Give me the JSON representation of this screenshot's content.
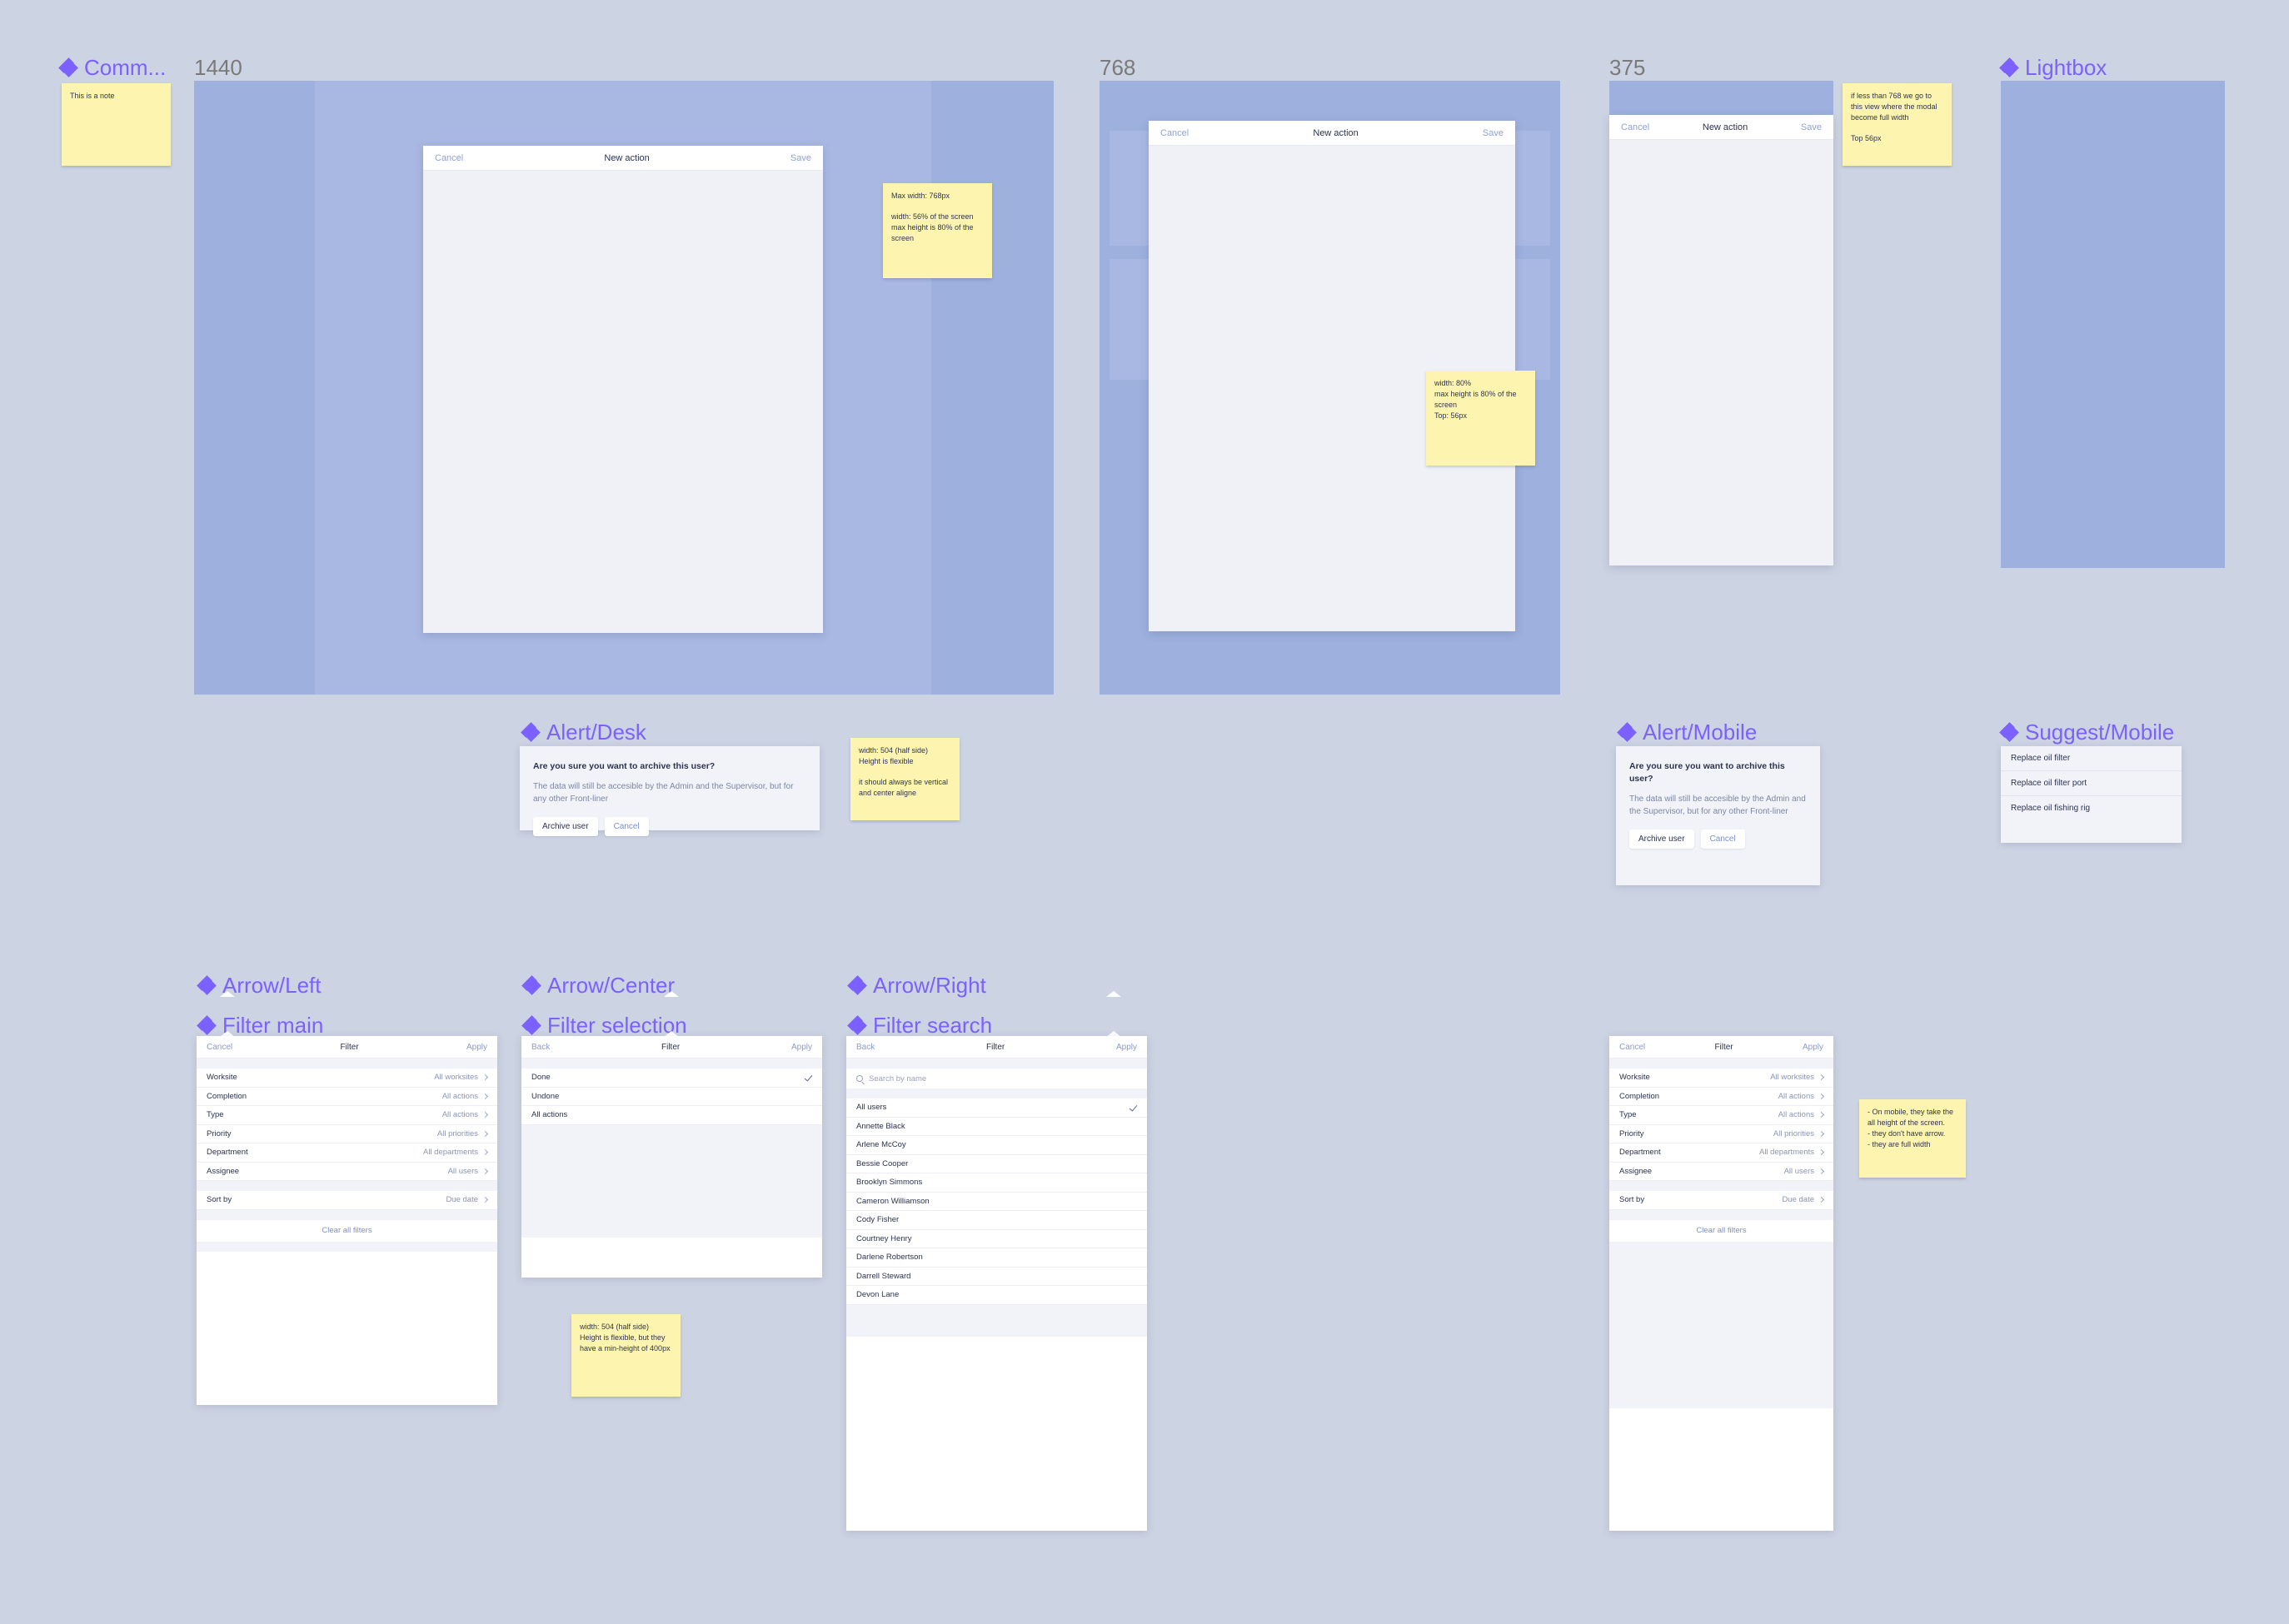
{
  "canvas": {
    "background": "#ccd3e3",
    "component_color": "#7b61ff",
    "frame_fill": "#9db0de"
  },
  "component_labels": {
    "comment": "Comm...",
    "lightbox": "Lightbox",
    "alert_desk": "Alert/Desk",
    "alert_mobile": "Alert/Mobile",
    "suggest_mobile": "Suggest/Mobile",
    "arrow_left": "Arrow/Left",
    "arrow_center": "Arrow/Center",
    "arrow_right": "Arrow/Right",
    "filter_main": "Filter main",
    "filter_selection": "Filter selection",
    "filter_search": "Filter search"
  },
  "frames": {
    "desktop_1440": "1440",
    "tablet_768": "768",
    "mobile_375": "375"
  },
  "notes": {
    "comment_note": [
      "This is a note"
    ],
    "desktop_modal": [
      "Max width: 768px",
      "width: 56% of the screen",
      "max height is 80% of the screen"
    ],
    "tablet_modal": [
      "width: 80%",
      "max height is 80% of the screen",
      "Top: 56px"
    ],
    "mobile_modal": [
      "if less than 768 we go to this view where the modal become full width",
      "Top 56px"
    ],
    "alert_note": [
      "width: 504 (half side)",
      "Height is flexible",
      "it should always be vertical and center aligne"
    ],
    "filter_note": [
      "width: 504 (half side)",
      "Height is flexible, but they have a min-height of 400px"
    ],
    "mobile_filter_note": [
      "- On mobile, they take the all height of the screen.",
      "- they don't have arrow.",
      "- they are full width"
    ]
  },
  "modal": {
    "cancel": "Cancel",
    "title": "New action",
    "save": "Save"
  },
  "alert": {
    "heading": "Are you sure you want to archive this user?",
    "body": "The data will still be accesible by the Admin and the Supervisor, but for any other Front-liner",
    "confirm": "Archive user",
    "cancel": "Cancel"
  },
  "suggest": {
    "items": [
      "Replace oil filter",
      "Replace oil filter port",
      "Replace oil fishing rig"
    ]
  },
  "filter_main": {
    "cancel": "Cancel",
    "title": "Filter",
    "apply": "Apply",
    "rows": [
      {
        "label": "Worksite",
        "value": "All worksites"
      },
      {
        "label": "Completion",
        "value": "All actions"
      },
      {
        "label": "Type",
        "value": "All actions"
      },
      {
        "label": "Priority",
        "value": "All priorities"
      },
      {
        "label": "Department",
        "value": "All departments"
      },
      {
        "label": "Assignee",
        "value": "All users"
      }
    ],
    "sort": {
      "label": "Sort by",
      "value": "Due date"
    },
    "clear": "Clear all filters"
  },
  "filter_selection": {
    "back": "Back",
    "title": "Filter",
    "apply": "Apply",
    "options": [
      {
        "label": "Done",
        "selected": true
      },
      {
        "label": "Undone",
        "selected": false
      },
      {
        "label": "All actions",
        "selected": false
      }
    ]
  },
  "filter_search": {
    "back": "Back",
    "title": "Filter",
    "apply": "Apply",
    "search_placeholder": "Search by name",
    "search_value": "",
    "options": [
      {
        "label": "All users",
        "selected": true
      },
      {
        "label": "Annette Black",
        "selected": false
      },
      {
        "label": "Arlene McCoy",
        "selected": false
      },
      {
        "label": "Bessie Cooper",
        "selected": false
      },
      {
        "label": "Brooklyn Simmons",
        "selected": false
      },
      {
        "label": "Cameron Williamson",
        "selected": false
      },
      {
        "label": "Cody Fisher",
        "selected": false
      },
      {
        "label": "Courtney Henry",
        "selected": false
      },
      {
        "label": "Darlene Robertson",
        "selected": false
      },
      {
        "label": "Darrell Steward",
        "selected": false
      },
      {
        "label": "Devon Lane",
        "selected": false
      }
    ]
  }
}
